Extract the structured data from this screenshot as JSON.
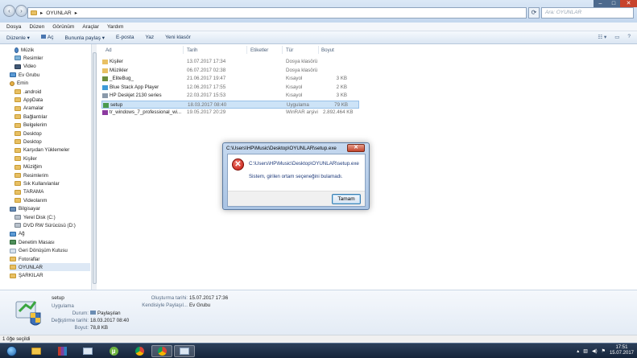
{
  "address": {
    "root_icon": "folder-icon",
    "crumb": "OYUNLAR"
  },
  "search": {
    "placeholder": "Ara: OYUNLAR"
  },
  "menu": [
    "Dosya",
    "Düzen",
    "Görünüm",
    "Araçlar",
    "Yardım"
  ],
  "commands": {
    "organize": "Düzenle ▾",
    "open": "Aç",
    "share": "Bununla paylaş ▾",
    "email": "E-posta",
    "print": "Yaz",
    "new_folder": "Yeni klasör"
  },
  "sidebar": [
    {
      "label": "Müzik",
      "icon": "music-icon",
      "indent": 1
    },
    {
      "label": "Resimler",
      "icon": "pictures-icon",
      "indent": 1
    },
    {
      "label": "Video",
      "icon": "video-icon",
      "indent": 1
    },
    {
      "label": "Ev Grubu",
      "icon": "homegroup-icon",
      "indent": 0
    },
    {
      "label": "Emin",
      "icon": "user-icon",
      "indent": 0
    },
    {
      "label": ".android",
      "icon": "folder-icon",
      "indent": 1
    },
    {
      "label": "AppData",
      "icon": "folder-icon",
      "indent": 1
    },
    {
      "label": "Aramalar",
      "icon": "folder-icon",
      "indent": 1
    },
    {
      "label": "Bağlantılar",
      "icon": "folder-icon",
      "indent": 1
    },
    {
      "label": "Belgelerim",
      "icon": "folder-icon",
      "indent": 1
    },
    {
      "label": "Desktop",
      "icon": "folder-icon",
      "indent": 1
    },
    {
      "label": "Desktop",
      "icon": "folder-icon",
      "indent": 1
    },
    {
      "label": "Karşıdan Yüklemeler",
      "icon": "folder-icon",
      "indent": 1
    },
    {
      "label": "Kişiler",
      "icon": "folder-icon",
      "indent": 1
    },
    {
      "label": "Müziğim",
      "icon": "folder-icon",
      "indent": 1
    },
    {
      "label": "Resimlerim",
      "icon": "folder-icon",
      "indent": 1
    },
    {
      "label": "Sık Kullanılanlar",
      "icon": "folder-icon",
      "indent": 1
    },
    {
      "label": "TARAMA",
      "icon": "folder-icon",
      "indent": 1
    },
    {
      "label": "Videolarım",
      "icon": "folder-icon",
      "indent": 1
    },
    {
      "label": "Bilgisayar",
      "icon": "computer-icon",
      "indent": 0
    },
    {
      "label": "Yerel Disk (C:)",
      "icon": "disk-icon",
      "indent": 1
    },
    {
      "label": "DVD RW Sürücüsü (D:)",
      "icon": "dvd-icon",
      "indent": 1
    },
    {
      "label": "Ağ",
      "icon": "network-icon",
      "indent": 0
    },
    {
      "label": "Denetim Masası",
      "icon": "control-panel-icon",
      "indent": 0
    },
    {
      "label": "Geri Dönüşüm Kutusu",
      "icon": "recycle-bin-icon",
      "indent": 0
    },
    {
      "label": "Fotoraflar",
      "icon": "folder-icon",
      "indent": 0
    },
    {
      "label": "OYUNLAR",
      "icon": "folder-icon",
      "indent": 0,
      "selected": true
    },
    {
      "label": "ŞARKILAR",
      "icon": "folder-icon",
      "indent": 0
    }
  ],
  "columns": {
    "name": "Ad",
    "date": "Tarih",
    "tags": "Etiketler",
    "type": "Tür",
    "size": "Boyut"
  },
  "files": [
    {
      "name": "Kişiler",
      "date": "13.07.2017 17:34",
      "type": "Dosya klasörü",
      "size": "",
      "icon": "folder-icon"
    },
    {
      "name": "Müzikler",
      "date": "06.07.2017 02:38",
      "type": "Dosya klasörü",
      "size": "",
      "icon": "folder-icon"
    },
    {
      "name": "_EliteBug_",
      "date": "21.06.2017 19:47",
      "type": "Kısayol",
      "size": "3 KB",
      "icon": "shortcut-icon"
    },
    {
      "name": "Blue Stack App Player",
      "date": "12.06.2017 17:55",
      "type": "Kısayol",
      "size": "2 KB",
      "icon": "bluestacks-icon"
    },
    {
      "name": "HP Deskjet 2130 series",
      "date": "22.03.2017 15:53",
      "type": "Kısayol",
      "size": "3 KB",
      "icon": "printer-icon"
    },
    {
      "name": "setup",
      "date": "18.03.2017 08:40",
      "type": "Uygulama",
      "size": "79 KB",
      "icon": "setup-icon",
      "selected": true
    },
    {
      "name": "tr_windows_7_professional_wi...",
      "date": "19.05.2017 20:29",
      "type": "WinRAR arşivi",
      "size": "2.892.464 KB",
      "icon": "winrar-icon"
    }
  ],
  "dialog": {
    "title": "C:\\Users\\HP\\Music\\Desktop\\OYUNLAR\\setup.exe",
    "path": "C:\\Users\\HP\\Music\\Desktop\\OYUNLAR\\setup.exe",
    "message": "Sistem, girilen ortam seçeneğini bulamadı.",
    "ok": "Tamam",
    "close": "✕"
  },
  "details": {
    "name": "setup",
    "kind": "Uygulama",
    "state_label": "Durum:",
    "state_value": "Paylaşılan",
    "modified_label": "Değiştirme tarihi:",
    "modified_value": "18.03.2017 08:40",
    "size_label": "Boyut:",
    "size_value": "78,8 KB",
    "created_label": "Oluşturma tarihi:",
    "created_value": "15.07.2017 17:36",
    "shared_label": "Kendisiyle Paylaşıl...",
    "shared_value": "Ev Grubu"
  },
  "status": {
    "text": "1 öğe seçildi"
  },
  "taskbar": {
    "time": "17:51",
    "date": "15.07.2017",
    "apps": [
      "start-orb",
      "explorer-icon",
      "winrar-icon",
      "media-icon",
      "utorrent-icon",
      "chrome-icon",
      "chrome-icon",
      "window-icon"
    ]
  }
}
